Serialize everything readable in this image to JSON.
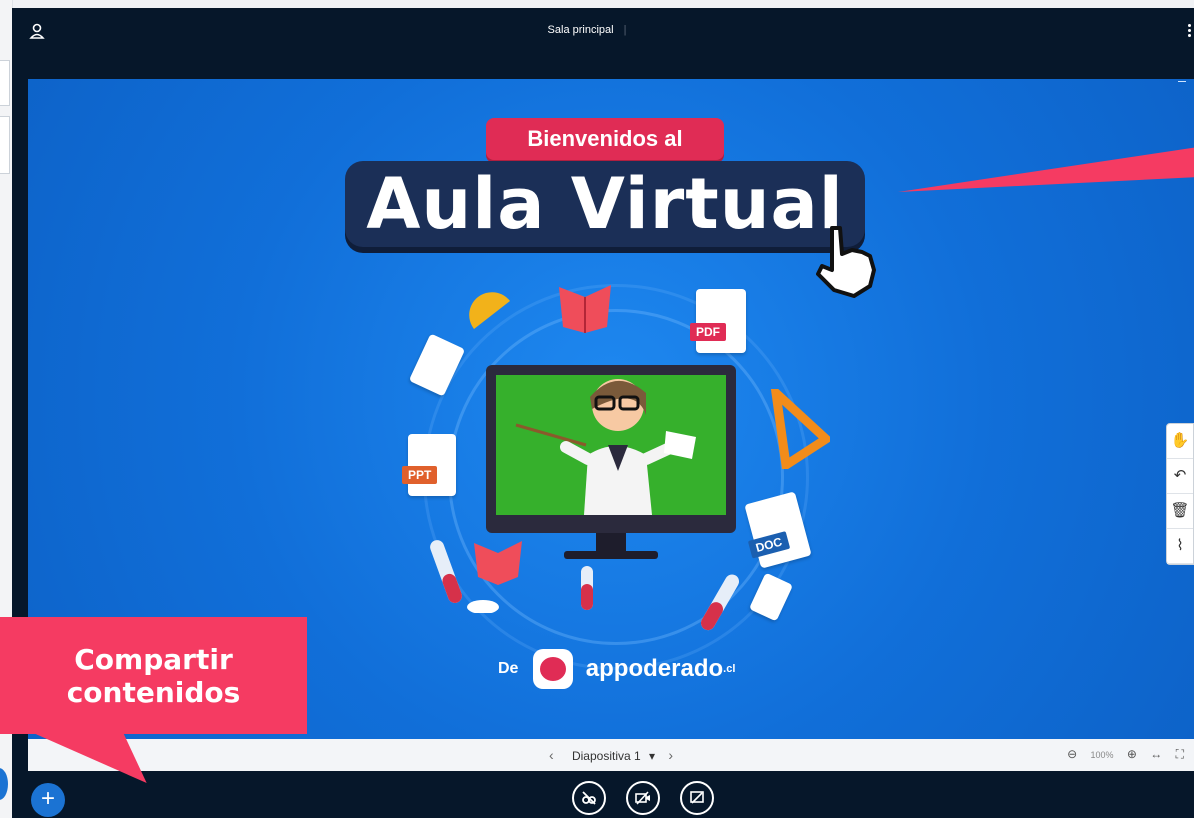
{
  "topbar": {
    "title": "Sala principal"
  },
  "slide": {
    "banner_small": "Bienvenidos al",
    "banner_big": "Aula Virtual",
    "doc_tags": [
      "PDF",
      "PPT",
      "DOC"
    ],
    "brand_prefix": "De",
    "brand_name": "appoderado",
    "brand_suffix": ".cl"
  },
  "presentation": {
    "slide_label": "Diapositiva 1",
    "zoom": "100%"
  },
  "callout": {
    "line1": "Compartir",
    "line2": "contenidos"
  },
  "colors": {
    "accent": "#1b73d3",
    "callout": "#f53b62",
    "dark": "#06172a"
  }
}
